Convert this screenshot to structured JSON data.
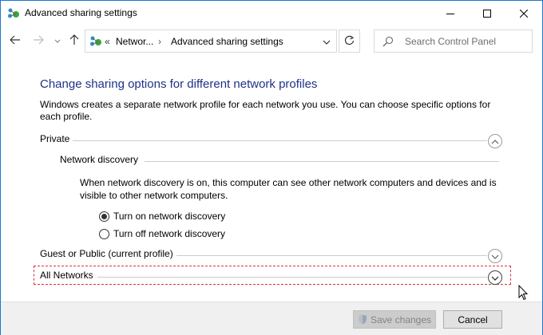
{
  "window": {
    "title": "Advanced sharing settings",
    "controls": {
      "minimize": "minimize-icon",
      "maximize": "maximize-icon",
      "close": "close-icon"
    }
  },
  "nav": {
    "back_icon": "arrow-left-icon",
    "forward_icon": "arrow-right-icon",
    "recent_icon": "chevron-down-icon",
    "up_icon": "arrow-up-icon",
    "breadcrumb": {
      "overflow": "«",
      "items": [
        "Networ...",
        "Advanced sharing settings"
      ],
      "separator": "›"
    },
    "refresh_icon": "refresh-icon",
    "search_placeholder": "Search Control Panel"
  },
  "content": {
    "title": "Change sharing options for different network profiles",
    "description": "Windows creates a separate network profile for each network you use. You can choose specific options for each profile.",
    "private": {
      "label": "Private",
      "expanded": true,
      "network_discovery": {
        "label": "Network discovery",
        "description": "When network discovery is on, this computer can see other network computers and devices and is visible to other network computers.",
        "options": [
          {
            "label": "Turn on network discovery",
            "selected": true
          },
          {
            "label": "Turn off network discovery",
            "selected": false
          }
        ]
      }
    },
    "guest_public": {
      "label": "Guest or Public (current profile)",
      "expanded": false
    },
    "all_networks": {
      "label": "All Networks",
      "expanded": false,
      "focused": true
    }
  },
  "footer": {
    "save_label": "Save changes",
    "save_enabled": false,
    "cancel_label": "Cancel"
  },
  "colors": {
    "title_blue": "#1e3287",
    "window_border": "#1979ca",
    "focus_dashed": "#e0303a"
  }
}
